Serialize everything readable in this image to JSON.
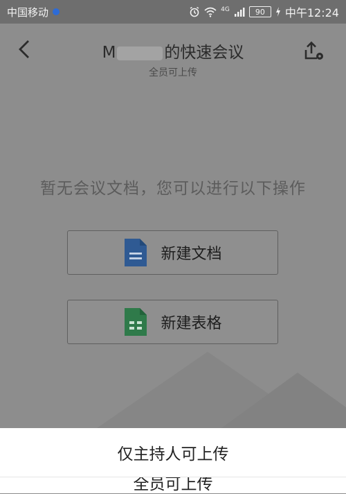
{
  "status_bar": {
    "carrier": "中国移动",
    "network": "4G",
    "battery": "90",
    "time": "中午12:24"
  },
  "header": {
    "title_prefix": "M",
    "title_suffix": "的快速会议",
    "subtitle": "全员可上传"
  },
  "empty_state": {
    "hint": "暂无会议文档，您可以进行以下操作"
  },
  "actions": {
    "new_document": "新建文档",
    "new_sheet": "新建表格"
  },
  "colors": {
    "doc_blue": "#2d6bd6",
    "sheet_green": "#1f9d55"
  },
  "bottom_sheet": {
    "options": [
      "仅主持人可上传",
      "全员可上传"
    ]
  }
}
